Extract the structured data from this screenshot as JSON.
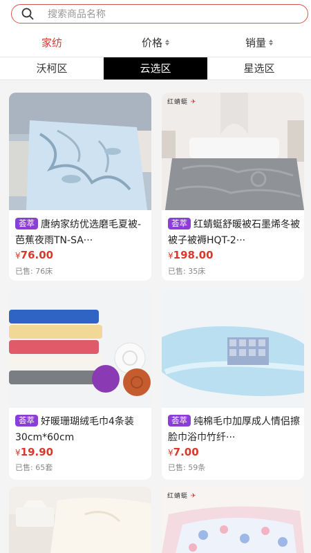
{
  "search": {
    "placeholder": "搜索商品名称",
    "icon": "search-icon"
  },
  "sort_tabs": [
    {
      "label": "家纺",
      "active": true
    },
    {
      "label": "价格"
    },
    {
      "label": "销量"
    }
  ],
  "zone_tabs": [
    {
      "label": "沃柯区"
    },
    {
      "label": "云选区",
      "active": true
    },
    {
      "label": "星选区"
    }
  ],
  "products": [
    {
      "tag": "荟萃",
      "title": "唐纳家纺优选磨毛夏被-芭蕉夜雨TN-SA···",
      "price": "76.00",
      "currency": "¥",
      "sold": "已售: 76床"
    },
    {
      "tag": "荟萃",
      "title": "红蜻蜓舒暖被石墨烯冬被被子被褥HQT-2···",
      "price": "198.00",
      "currency": "¥",
      "sold": "已售: 35床",
      "brand_mark": "红蜻蜓"
    },
    {
      "tag": "荟萃",
      "title": "好暖珊瑚绒毛巾4条装30cm*60cm",
      "price": "19.90",
      "currency": "¥",
      "sold": "已售: 65套"
    },
    {
      "tag": "荟萃",
      "title": "纯棉毛巾加厚成人情侣擦脸巾浴巾竹纤···",
      "price": "7.00",
      "currency": "¥",
      "sold": "已售: 59条"
    },
    {
      "brand_mark": "红蜻蜓"
    }
  ],
  "colors": {
    "accent": "#d9382c",
    "tag": "#8a3ed8",
    "active_zone": "#000000"
  }
}
